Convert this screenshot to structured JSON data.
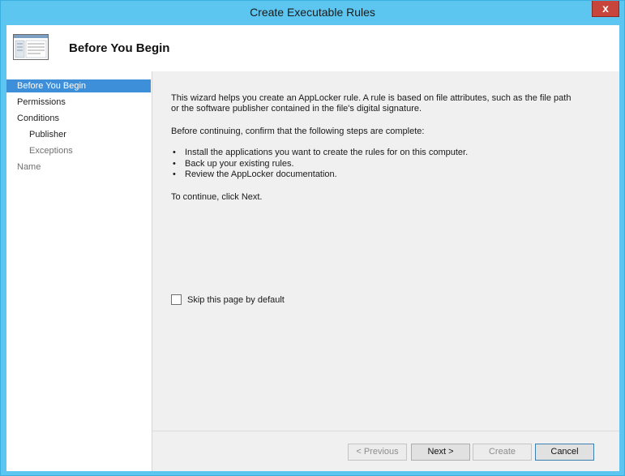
{
  "window": {
    "title": "Create Executable Rules",
    "close_symbol": "x"
  },
  "header": {
    "icon": "wizard-window-icon",
    "title": "Before You Begin"
  },
  "sidebar": {
    "items": [
      {
        "label": "Before You Begin",
        "state": "active"
      },
      {
        "label": "Permissions",
        "state": "normal"
      },
      {
        "label": "Conditions",
        "state": "normal"
      },
      {
        "label": "Publisher",
        "state": "normal"
      },
      {
        "label": "Exceptions",
        "state": "disabled"
      },
      {
        "label": "Name",
        "state": "disabled"
      }
    ]
  },
  "content": {
    "intro": "This wizard helps you create an AppLocker rule. A rule is based on file attributes, such as the file path or the software publisher contained in the file's digital signature.",
    "before_continuing": "Before continuing, confirm that the following steps are complete:",
    "steps": [
      "Install the applications you want to create the rules for on this computer.",
      "Back up your existing rules.",
      "Review the AppLocker documentation."
    ],
    "continue_text": "To continue, click Next.",
    "skip_label": "Skip this page by default"
  },
  "footer": {
    "previous_label": "< Previous",
    "next_label": "Next >",
    "create_label": "Create",
    "cancel_label": "Cancel"
  },
  "colors": {
    "frame": "#5dc6f0",
    "selection": "#3c8fd8",
    "close_button": "#c7453a"
  }
}
